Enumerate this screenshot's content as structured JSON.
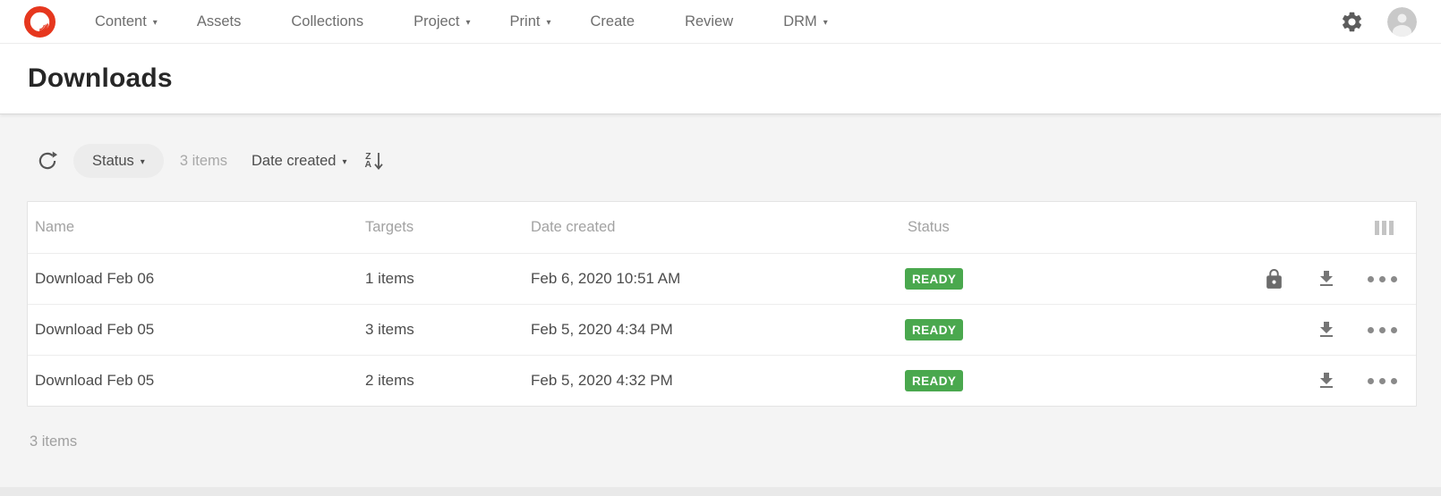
{
  "nav": {
    "items": [
      {
        "label": "Content",
        "has_caret": true
      },
      {
        "label": "Assets",
        "has_caret": false
      },
      {
        "label": "Collections",
        "has_caret": false
      },
      {
        "label": "Project",
        "has_caret": true
      },
      {
        "label": "Print",
        "has_caret": true
      },
      {
        "label": "Create",
        "has_caret": false
      },
      {
        "label": "Review",
        "has_caret": false
      },
      {
        "label": "DRM",
        "has_caret": true
      }
    ]
  },
  "icons": {
    "caret_down": "▾",
    "brand": "brand-ring-logo",
    "settings": "gear-icon",
    "account": "user-avatar-icon",
    "refresh": "refresh-icon",
    "sort_direction": "sort-descending-icon",
    "columns": "column-settings-icon",
    "lock": "lock-icon",
    "download": "download-icon",
    "more": "ellipsis-icon"
  },
  "page": {
    "title": "Downloads"
  },
  "toolbar": {
    "status_label": "Status",
    "items_count": "3 items",
    "sort_field": "Date created",
    "sort_letters": {
      "top": "Z",
      "bottom": "A"
    }
  },
  "table": {
    "headers": [
      "Name",
      "Targets",
      "Date created",
      "Status"
    ],
    "rows": [
      {
        "name": "Download Feb 06",
        "targets": "1 items",
        "date_created": "Feb 6, 2020 10:51 AM",
        "status": "READY",
        "locked": true
      },
      {
        "name": "Download Feb 05",
        "targets": "3 items",
        "date_created": "Feb 5, 2020 4:34 PM",
        "status": "READY",
        "locked": false
      },
      {
        "name": "Download Feb 05",
        "targets": "2 items",
        "date_created": "Feb 5, 2020 4:32 PM",
        "status": "READY",
        "locked": false
      }
    ]
  },
  "footer": {
    "items_count": "3 items"
  },
  "colors": {
    "brand_red": "#e6371e",
    "ready_green": "#4aa84e",
    "page_bg": "#f4f4f4"
  }
}
